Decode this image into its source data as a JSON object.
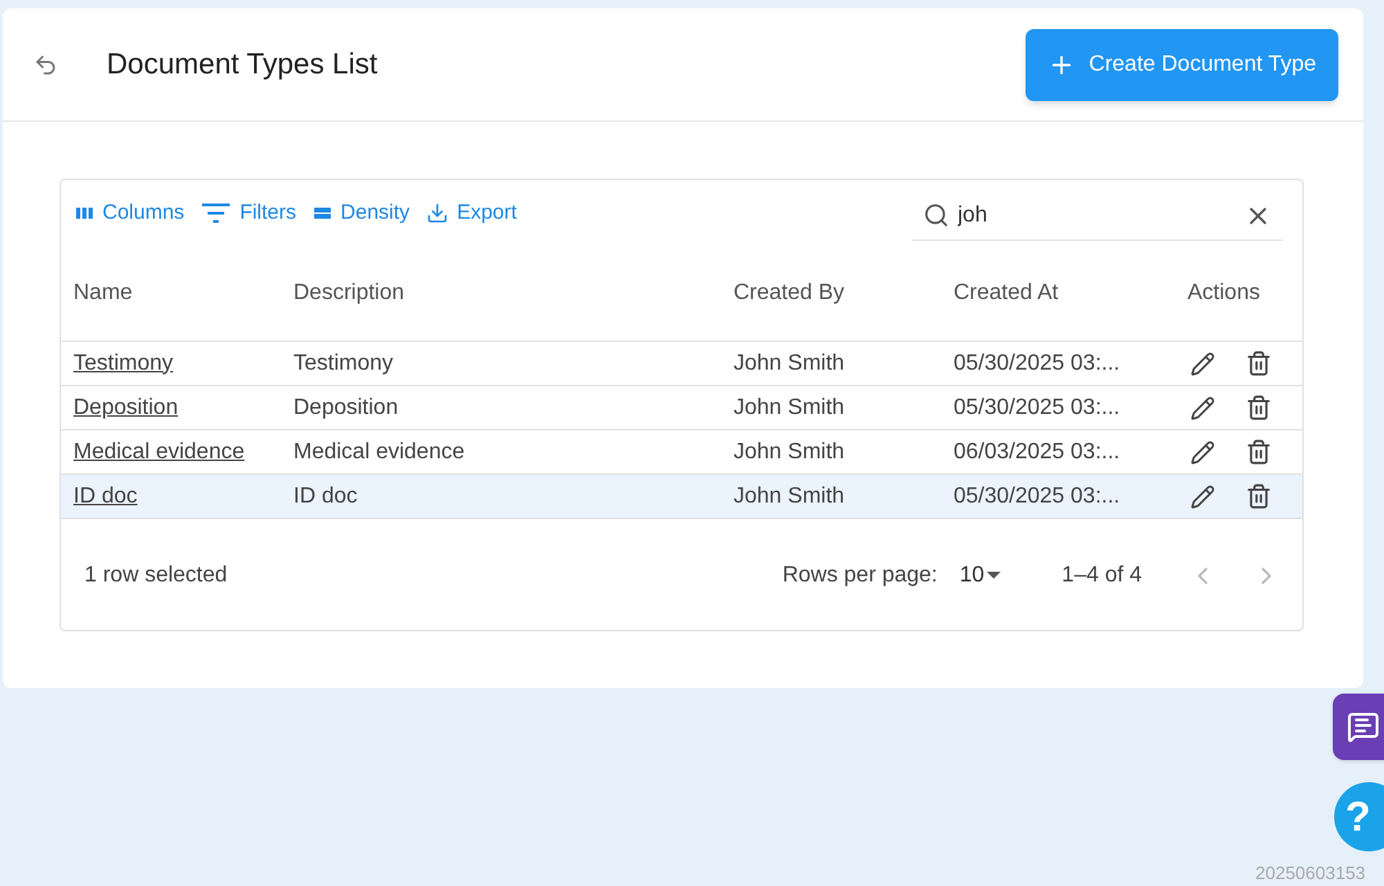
{
  "header": {
    "title": "Document Types List",
    "create_button": "Create Document Type"
  },
  "toolbar": {
    "buttons": [
      {
        "label": "Columns",
        "kind": "columns"
      },
      {
        "label": "Filters",
        "kind": "filters"
      },
      {
        "label": "Density",
        "kind": "density"
      },
      {
        "label": "Export",
        "kind": "export"
      }
    ],
    "search": {
      "value": "joh"
    }
  },
  "table": {
    "columns": [
      "Name",
      "Description",
      "Created By",
      "Created At",
      "Actions"
    ],
    "rows": [
      {
        "name": "Testimony",
        "description": "Testimony",
        "created_by": "John Smith",
        "created_at": "05/30/2025 03:...",
        "selected": false
      },
      {
        "name": "Deposition",
        "description": "Deposition",
        "created_by": "John Smith",
        "created_at": "05/30/2025 03:...",
        "selected": false
      },
      {
        "name": "Medical evidence",
        "description": "Medical evidence",
        "created_by": "John Smith",
        "created_at": "06/03/2025 03:...",
        "selected": false
      },
      {
        "name": "ID doc",
        "description": "ID doc",
        "created_by": "John Smith",
        "created_at": "05/30/2025 03:...",
        "selected": true
      }
    ]
  },
  "footer": {
    "selection": "1 row selected",
    "rows_per_page_label": "Rows per page:",
    "rows_per_page": "10",
    "range": "1–4 of 4"
  },
  "help_button": "?",
  "version": "20250603153"
}
